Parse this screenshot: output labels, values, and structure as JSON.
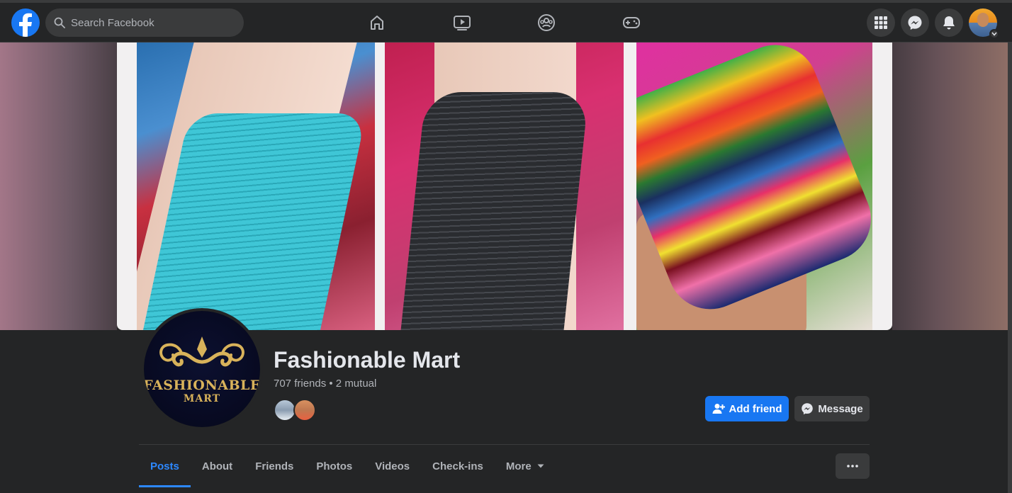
{
  "topbar": {
    "search_placeholder": "Search Facebook",
    "nav": [
      "home-icon",
      "watch-icon",
      "groups-icon",
      "gaming-icon"
    ],
    "right": [
      "menu-grid-icon",
      "messenger-icon",
      "notifications-icon",
      "account-avatar"
    ]
  },
  "profile": {
    "name": "Fashionable Mart",
    "friends_line": "707 friends • 2 mutual",
    "logo_line1": "FASHIONABLE",
    "logo_line2": "MART"
  },
  "actions": {
    "add_friend": "Add friend",
    "message": "Message"
  },
  "tabs": [
    {
      "label": "Posts",
      "active": true
    },
    {
      "label": "About"
    },
    {
      "label": "Friends"
    },
    {
      "label": "Photos"
    },
    {
      "label": "Videos"
    },
    {
      "label": "Check-ins"
    },
    {
      "label": "More"
    }
  ],
  "colors": {
    "accent": "#1877f2",
    "active_tab": "#2d88ff",
    "background": "#18191a",
    "surface": "#242526"
  }
}
